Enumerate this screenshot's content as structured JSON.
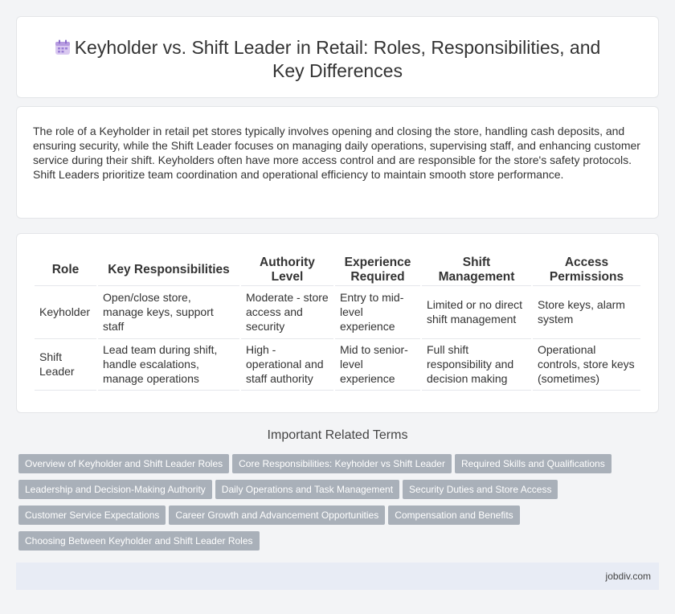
{
  "header": {
    "title_line1": "Keyholder vs. Shift Leader in Retail: Roles, Responsibilities, and",
    "title_line2": "Key Differences",
    "icon": "calendar-icon"
  },
  "intro": {
    "text": "The role of a Keyholder in retail pet stores typically involves opening and closing the store, handling cash deposits, and ensuring security, while the Shift Leader focuses on managing daily operations, supervising staff, and enhancing customer service during their shift. Keyholders often have more access control and are responsible for the store's safety protocols. Shift Leaders prioritize team coordination and operational efficiency to maintain smooth store performance."
  },
  "table": {
    "headers": [
      "Role",
      "Key Responsibilities",
      "Authority Level",
      "Experience Required",
      "Shift Management",
      "Access Permissions"
    ],
    "rows": [
      [
        "Keyholder",
        "Open/close store, manage keys, support staff",
        "Moderate - store access and security",
        "Entry to mid-level experience",
        "Limited or no direct shift management",
        "Store keys, alarm system"
      ],
      [
        "Shift Leader",
        "Lead team during shift, handle escalations, manage operations",
        "High - operational and staff authority",
        "Mid to senior-level experience",
        "Full shift responsibility and decision making",
        "Operational controls, store keys (sometimes)"
      ]
    ]
  },
  "related": {
    "title": "Important Related Terms",
    "tags": [
      "Overview of Keyholder and Shift Leader Roles",
      "Core Responsibilities: Keyholder vs Shift Leader",
      "Required Skills and Qualifications",
      "Leadership and Decision-Making Authority",
      "Daily Operations and Task Management",
      "Security Duties and Store Access",
      "Customer Service Expectations",
      "Career Growth and Advancement Opportunities",
      "Compensation and Benefits",
      "Choosing Between Keyholder and Shift Leader Roles"
    ]
  },
  "footer": {
    "site": "jobdiv.com"
  }
}
